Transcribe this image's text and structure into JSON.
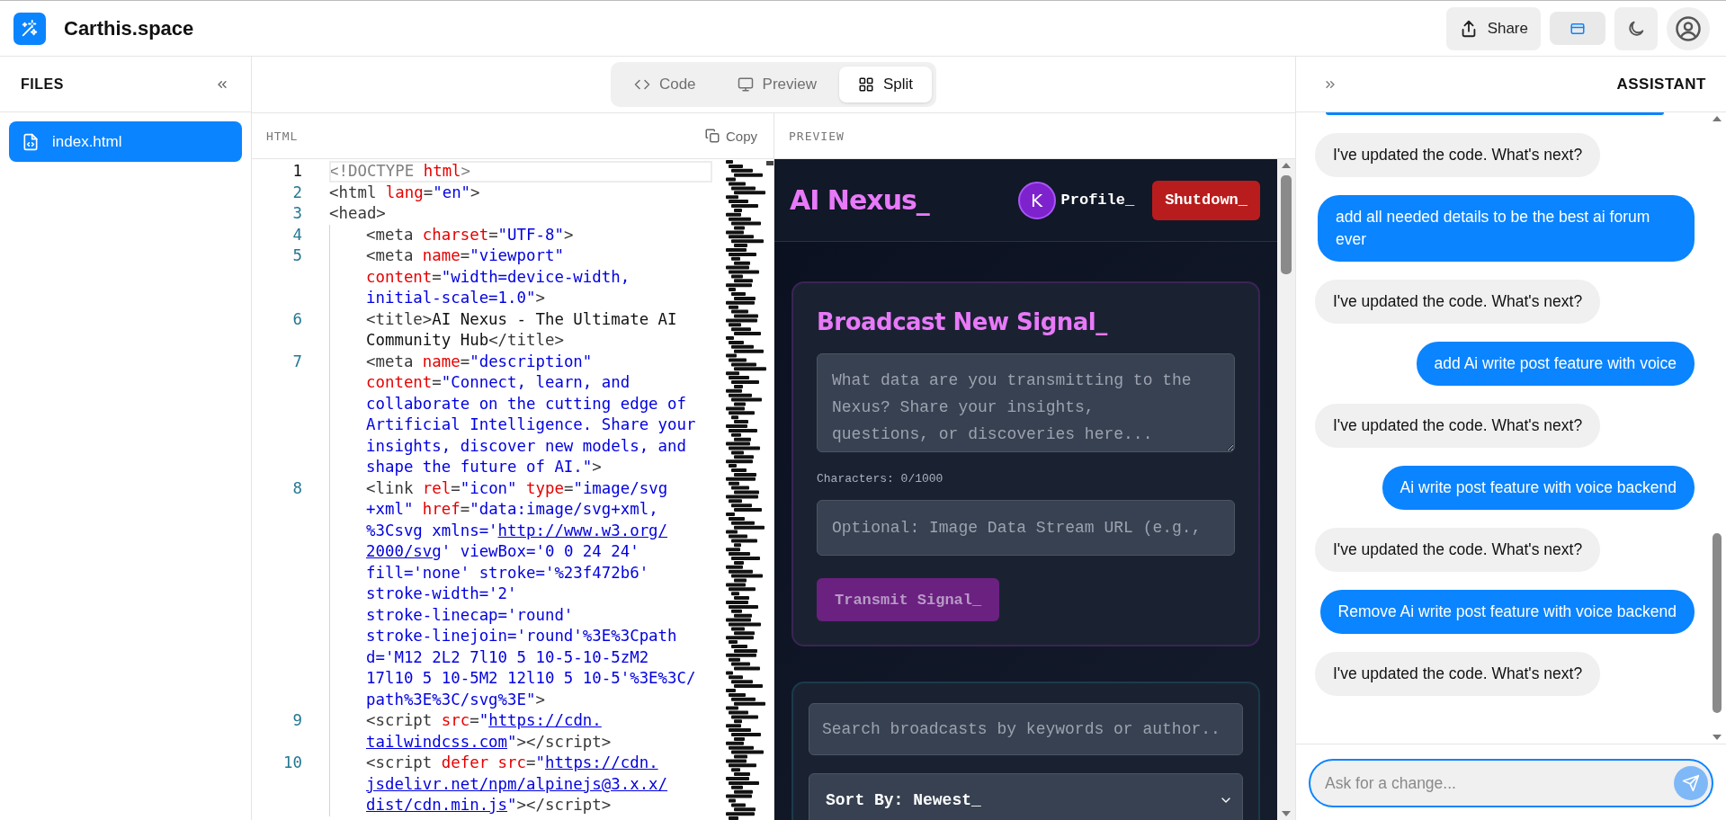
{
  "app": {
    "title": "Carthis.space",
    "share": "Share"
  },
  "files": {
    "title": "FILES",
    "items": [
      {
        "name": "index.html",
        "selected": true
      }
    ]
  },
  "view_tabs": [
    {
      "label": "Code",
      "kind": "code",
      "selected": false
    },
    {
      "label": "Preview",
      "kind": "preview",
      "selected": false
    },
    {
      "label": "Split",
      "kind": "split",
      "selected": true
    }
  ],
  "editor": {
    "title": "HTML",
    "copy": "Copy",
    "lines": [
      {
        "number": "1",
        "current": true,
        "rows": [
          {
            "tokens": [
              {
                "text": "<!DOCTYPE ",
                "kind": "meta"
              },
              {
                "text": "html",
                "kind": "attr"
              },
              {
                "text": ">",
                "kind": "meta"
              }
            ]
          }
        ]
      },
      {
        "number": "2",
        "current": false,
        "rows": [
          {
            "tokens": [
              {
                "text": "<html",
                "kind": "tag"
              },
              {
                "text": " lang",
                "kind": "attr"
              },
              {
                "text": "=",
                "kind": "tag"
              },
              {
                "text": "\"en\"",
                "kind": "value"
              },
              {
                "text": ">",
                "kind": "tag"
              }
            ]
          }
        ]
      },
      {
        "number": "3",
        "current": false,
        "rows": [
          {
            "tokens": [
              {
                "text": "<head>",
                "kind": "tag"
              }
            ]
          }
        ],
        "children": [
          {
            "number": "4",
            "current": false,
            "rows": [
              {
                "tokens": [
                  {
                    "text": "<meta",
                    "kind": "tag"
                  },
                  {
                    "text": " charset",
                    "kind": "attr"
                  },
                  {
                    "text": "=",
                    "kind": "tag"
                  },
                  {
                    "text": "\"UTF-8\"",
                    "kind": "value"
                  },
                  {
                    "text": ">",
                    "kind": "tag"
                  }
                ]
              }
            ]
          },
          {
            "number": "5",
            "current": false,
            "rows": [
              {
                "tokens": [
                  {
                    "text": "<meta",
                    "kind": "tag"
                  },
                  {
                    "text": " name",
                    "kind": "attr"
                  },
                  {
                    "text": "=",
                    "kind": "tag"
                  },
                  {
                    "text": "\"viewport\"",
                    "kind": "value"
                  }
                ]
              },
              {
                "tokens": [
                  {
                    "text": "content",
                    "kind": "attr"
                  },
                  {
                    "text": "=",
                    "kind": "tag"
                  },
                  {
                    "text": "\"width=device-width,",
                    "kind": "value"
                  }
                ]
              },
              {
                "tokens": [
                  {
                    "text": "initial-scale=1.0\"",
                    "kind": "value"
                  },
                  {
                    "text": ">",
                    "kind": "tag"
                  }
                ]
              }
            ]
          },
          {
            "number": "6",
            "current": false,
            "rows": [
              {
                "tokens": [
                  {
                    "text": "<title>",
                    "kind": "tag"
                  },
                  {
                    "text": "AI Nexus - The Ultimate AI",
                    "kind": "text"
                  }
                ]
              },
              {
                "tokens": [
                  {
                    "text": "Community Hub",
                    "kind": "text"
                  },
                  {
                    "text": "</title>",
                    "kind": "tag"
                  }
                ]
              }
            ]
          },
          {
            "number": "7",
            "current": false,
            "rows": [
              {
                "tokens": [
                  {
                    "text": "<meta",
                    "kind": "tag"
                  },
                  {
                    "text": " name",
                    "kind": "attr"
                  },
                  {
                    "text": "=",
                    "kind": "tag"
                  },
                  {
                    "text": "\"description\"",
                    "kind": "value"
                  }
                ]
              },
              {
                "tokens": [
                  {
                    "text": "content",
                    "kind": "attr"
                  },
                  {
                    "text": "=",
                    "kind": "tag"
                  },
                  {
                    "text": "\"Connect, learn, and",
                    "kind": "value"
                  }
                ]
              },
              {
                "tokens": [
                  {
                    "text": "collaborate on the cutting edge of",
                    "kind": "value"
                  }
                ]
              },
              {
                "tokens": [
                  {
                    "text": "Artificial Intelligence. Share your",
                    "kind": "value"
                  }
                ]
              },
              {
                "tokens": [
                  {
                    "text": "insights, discover new models, and",
                    "kind": "value"
                  }
                ]
              },
              {
                "tokens": [
                  {
                    "text": "shape the future of AI.\"",
                    "kind": "value"
                  },
                  {
                    "text": ">",
                    "kind": "tag"
                  }
                ]
              }
            ]
          },
          {
            "number": "8",
            "current": false,
            "rows": [
              {
                "tokens": [
                  {
                    "text": "<link",
                    "kind": "tag"
                  },
                  {
                    "text": " rel",
                    "kind": "attr"
                  },
                  {
                    "text": "=",
                    "kind": "tag"
                  },
                  {
                    "text": "\"icon\"",
                    "kind": "value"
                  },
                  {
                    "text": " type",
                    "kind": "attr"
                  },
                  {
                    "text": "=",
                    "kind": "tag"
                  },
                  {
                    "text": "\"image/svg",
                    "kind": "value"
                  }
                ]
              },
              {
                "tokens": [
                  {
                    "text": "+xml\"",
                    "kind": "value"
                  },
                  {
                    "text": " href",
                    "kind": "attr"
                  },
                  {
                    "text": "=",
                    "kind": "tag"
                  },
                  {
                    "text": "\"data:image/svg+xml,",
                    "kind": "value"
                  }
                ]
              },
              {
                "tokens": [
                  {
                    "text": "%3Csvg xmlns='",
                    "kind": "value"
                  },
                  {
                    "text": "http://www.w3.org/",
                    "kind": "link"
                  }
                ]
              },
              {
                "tokens": [
                  {
                    "text": "2000/svg",
                    "kind": "link"
                  },
                  {
                    "text": "' viewBox='0 0 24 24'",
                    "kind": "value"
                  }
                ]
              },
              {
                "tokens": [
                  {
                    "text": "fill='none' stroke='%23f472b6'",
                    "kind": "value"
                  }
                ]
              },
              {
                "tokens": [
                  {
                    "text": "stroke-width='2'",
                    "kind": "value"
                  }
                ]
              },
              {
                "tokens": [
                  {
                    "text": "stroke-linecap='round'",
                    "kind": "value"
                  }
                ]
              },
              {
                "tokens": [
                  {
                    "text": "stroke-linejoin='round'%3E%3Cpath",
                    "kind": "value"
                  }
                ]
              },
              {
                "tokens": [
                  {
                    "text": "d='M12 2L2 7l10 5 10-5-10-5zM2",
                    "kind": "value"
                  }
                ]
              },
              {
                "tokens": [
                  {
                    "text": "17l10 5 10-5M2 12l10 5 10-5'%3E%3C/",
                    "kind": "value"
                  }
                ]
              },
              {
                "tokens": [
                  {
                    "text": "path%3E%3C/svg%3E\"",
                    "kind": "value"
                  },
                  {
                    "text": ">",
                    "kind": "tag"
                  }
                ]
              }
            ]
          },
          {
            "number": "9",
            "current": false,
            "rows": [
              {
                "tokens": [
                  {
                    "text": "<script",
                    "kind": "tag"
                  },
                  {
                    "text": " src",
                    "kind": "attr"
                  },
                  {
                    "text": "=",
                    "kind": "tag"
                  },
                  {
                    "text": "\"",
                    "kind": "value"
                  },
                  {
                    "text": "https://cdn.",
                    "kind": "link"
                  }
                ]
              },
              {
                "tokens": [
                  {
                    "text": "tailwindcss.com",
                    "kind": "link"
                  },
                  {
                    "text": "\"",
                    "kind": "value"
                  },
                  {
                    "text": "></script>",
                    "kind": "tag"
                  }
                ]
              }
            ]
          },
          {
            "number": "10",
            "current": false,
            "rows": [
              {
                "tokens": [
                  {
                    "text": "<script",
                    "kind": "tag"
                  },
                  {
                    "text": " defer",
                    "kind": "attr"
                  },
                  {
                    "text": " src",
                    "kind": "attr"
                  },
                  {
                    "text": "=",
                    "kind": "tag"
                  },
                  {
                    "text": "\"",
                    "kind": "value"
                  },
                  {
                    "text": "https://cdn.",
                    "kind": "link"
                  }
                ]
              },
              {
                "tokens": [
                  {
                    "text": "jsdelivr.net/npm/alpinejs@3.x.x/",
                    "kind": "link"
                  }
                ]
              },
              {
                "tokens": [
                  {
                    "text": "dist/cdn.min.js",
                    "kind": "link"
                  },
                  {
                    "text": "\"",
                    "kind": "value"
                  },
                  {
                    "text": "></script>",
                    "kind": "tag"
                  }
                ]
              }
            ]
          }
        ]
      }
    ]
  },
  "preview": {
    "title": "PREVIEW",
    "site": {
      "brand": "AI Nexus_",
      "avatar": "K",
      "profile": "Profile_",
      "shutdown": "Shutdown_",
      "composer": {
        "title": "Broadcast New Signal_",
        "message_placeholder": "What data are you transmitting to the Nexus? Share your insights, questions, or discoveries here...",
        "char_count": "Characters: 0/1000",
        "image_placeholder": "Optional: Image Data Stream URL (e.g.,",
        "submit": {
          "label": "Transmit Signal_",
          "disabled": true
        }
      },
      "feed": {
        "search_placeholder": "Search broadcasts by keywords or author..",
        "sort": "Sort By: Newest_"
      }
    }
  },
  "assistant": {
    "title": "ASSISTANT",
    "messages": [
      {
        "kind": "assistant",
        "text": "I've updated the code. What's next?"
      },
      {
        "kind": "user",
        "text": "add all needed details to be the best ai forum ever"
      },
      {
        "kind": "assistant",
        "text": "I've updated the code. What's next?"
      },
      {
        "kind": "user",
        "text": "add Ai write post feature with voice"
      },
      {
        "kind": "assistant",
        "text": "I've updated the code. What's next?"
      },
      {
        "kind": "user",
        "text": "Ai write post feature with voice backend"
      },
      {
        "kind": "assistant",
        "text": "I've updated the code. What's next?"
      },
      {
        "kind": "user",
        "text": "Remove Ai write post feature with voice backend"
      },
      {
        "kind": "assistant",
        "text": "I've updated the code. What's next?"
      }
    ],
    "input": {
      "placeholder": "Ask for a change..."
    }
  }
}
